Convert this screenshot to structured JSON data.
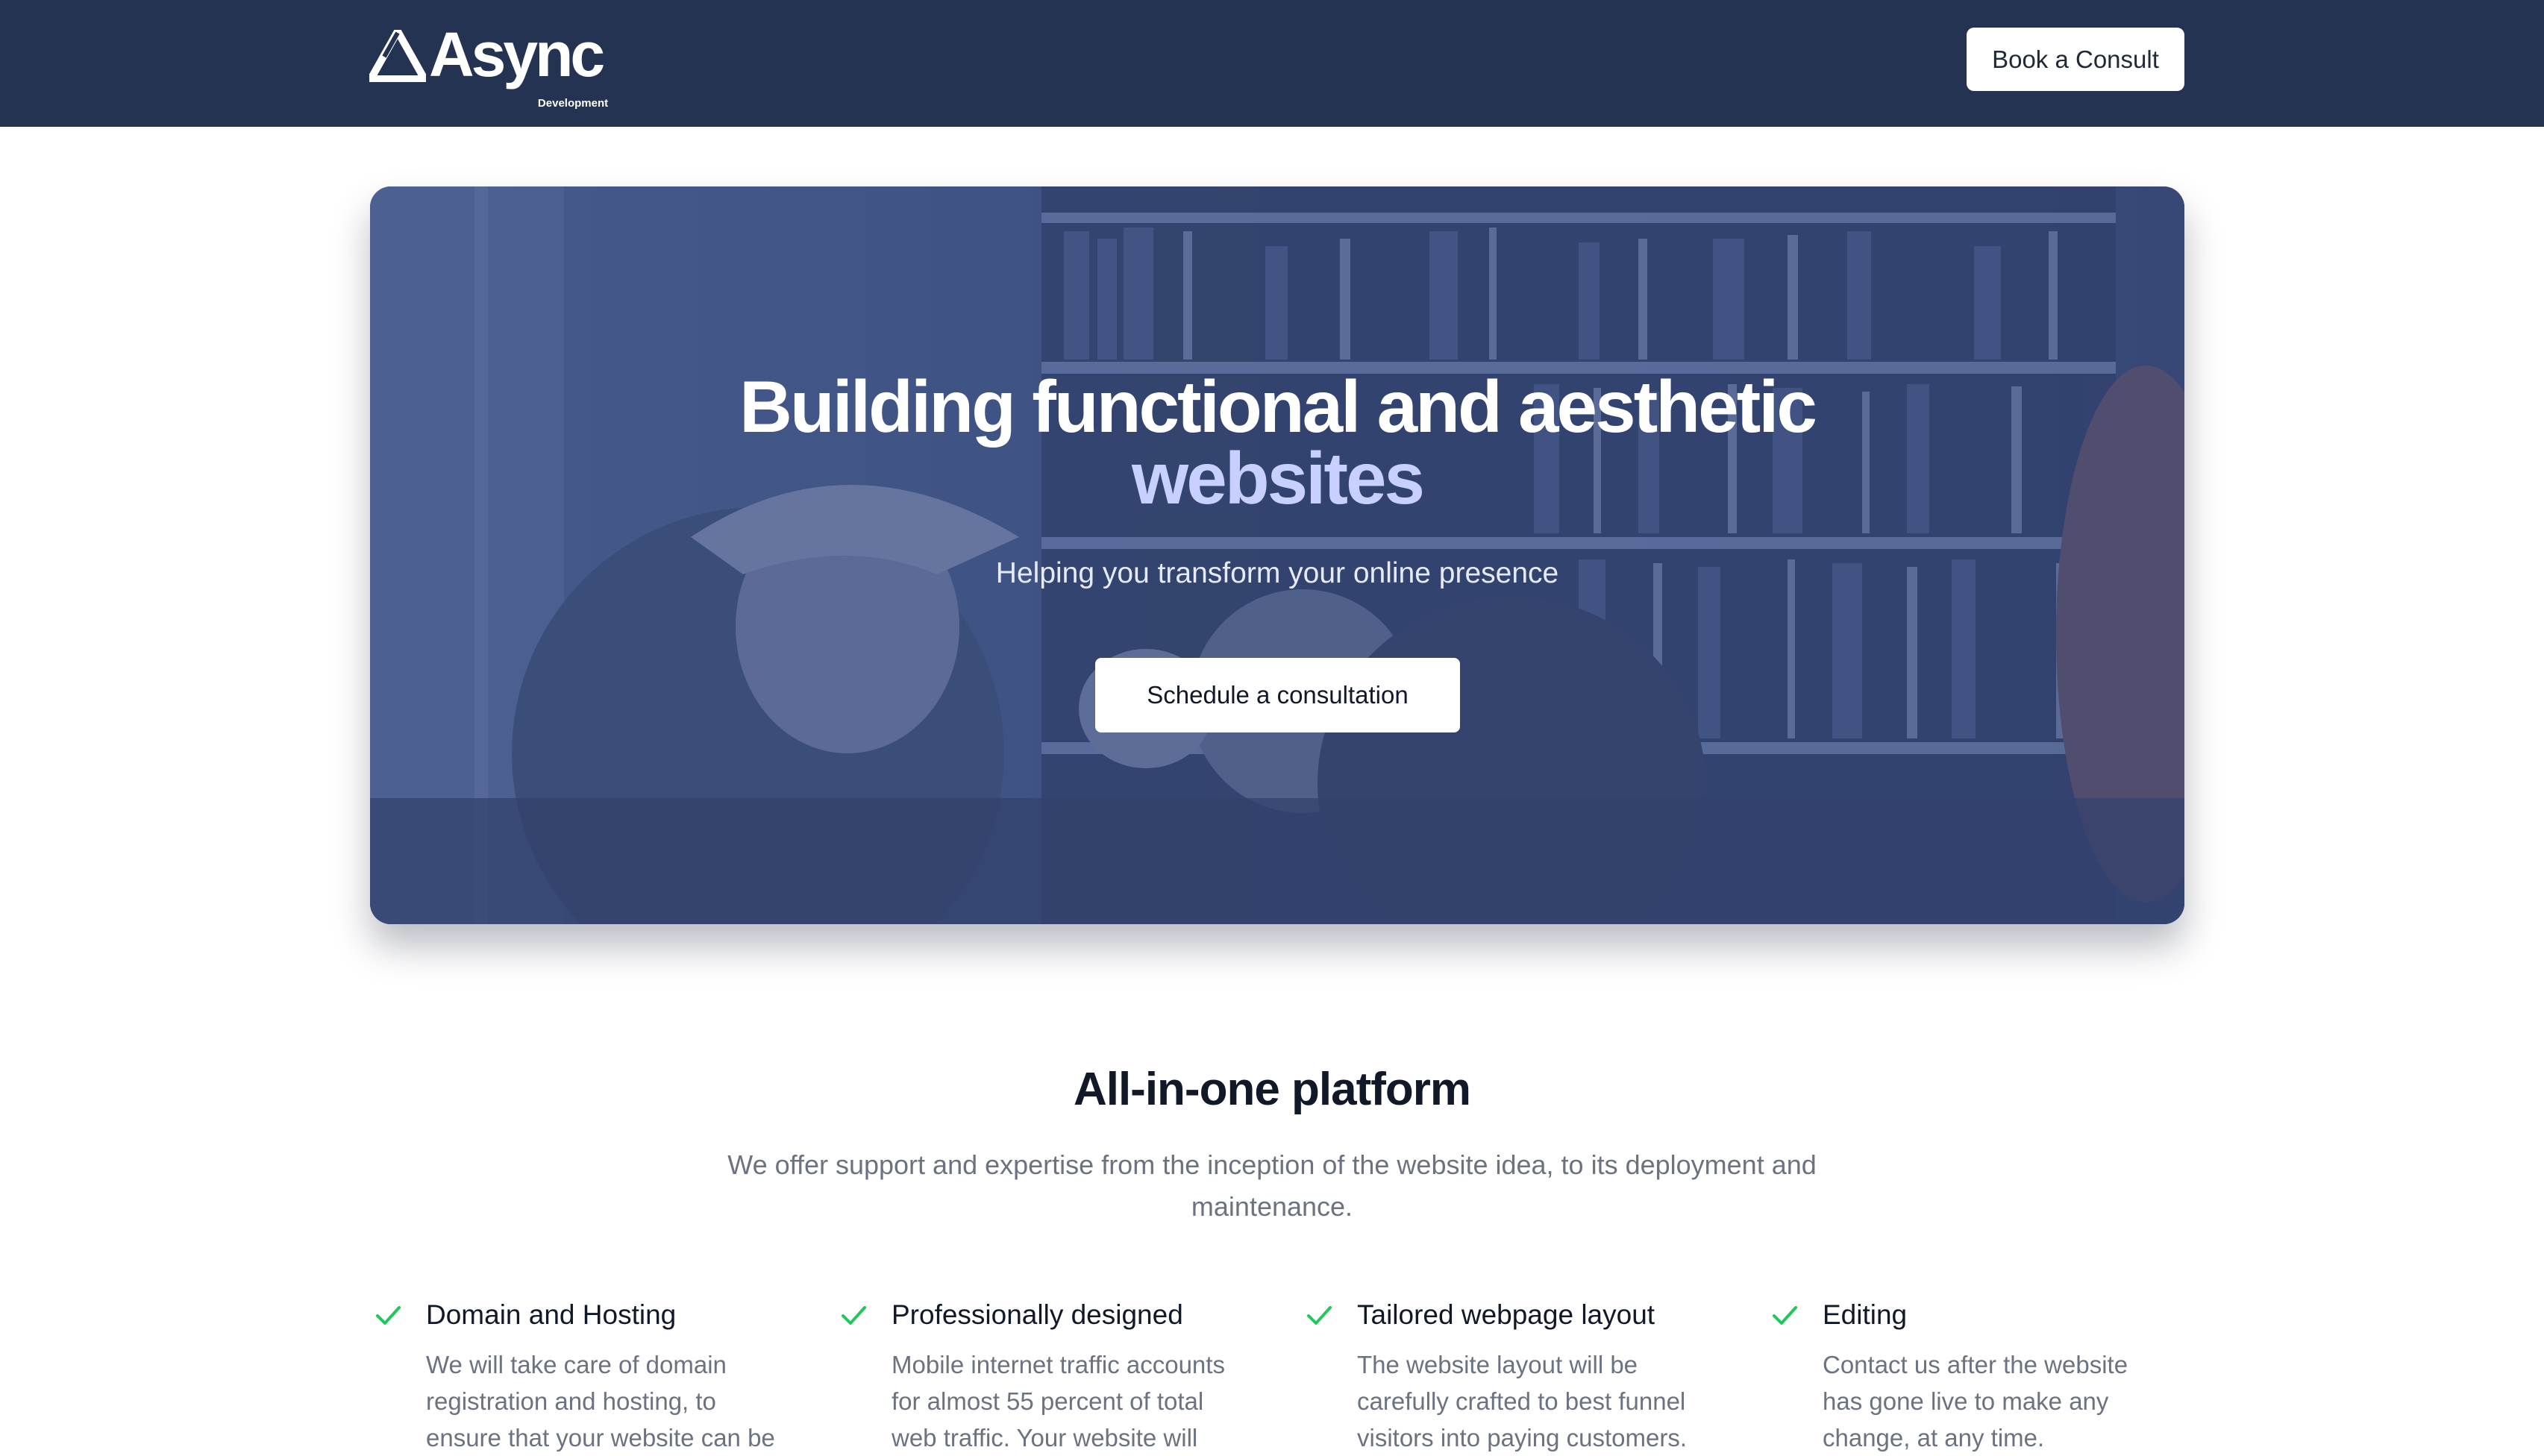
{
  "header": {
    "logo_text": "Async",
    "logo_subtext": "Development",
    "book_button_label": "Book a Consult"
  },
  "hero": {
    "title_line1": "Building functional and aesthetic",
    "title_line2": "websites",
    "subtitle": "Helping you transform your online presence",
    "cta_label": "Schedule a consultation"
  },
  "platform": {
    "title": "All-in-one platform",
    "description": "We offer support and expertise from the inception of the website idea, to its deployment and maintenance.",
    "features": [
      {
        "title": "Domain and Hosting",
        "description": "We will take care of domain registration and hosting, to ensure that your website can be"
      },
      {
        "title": "Professionally designed",
        "description": "Mobile internet traffic accounts for almost 55 percent of total web traffic. Your website will"
      },
      {
        "title": "Tailored webpage layout",
        "description": "The website layout will be carefully crafted to best funnel visitors into paying customers."
      },
      {
        "title": "Editing",
        "description": "Contact us after the website has gone live to make any change, at any time."
      }
    ]
  },
  "colors": {
    "header_bg": "#253352",
    "hero_overlay": "#3f5385",
    "title_accent": "#c7d0ff",
    "check_green": "#22c55e"
  },
  "icons": {
    "logo": "async-logo-icon",
    "feature_check": "check-icon"
  }
}
